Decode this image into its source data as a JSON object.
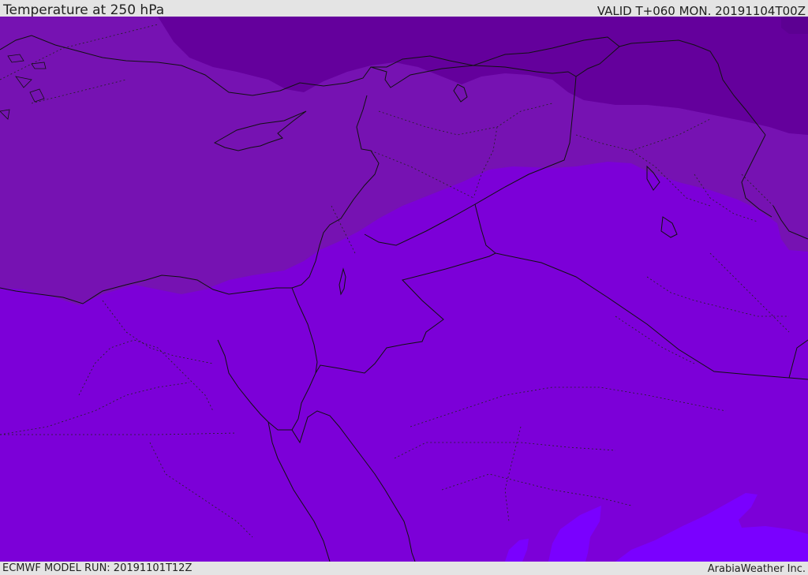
{
  "header": {
    "title": "Temperature at 250 hPa",
    "valid_time": "VALID T+060 MON. 20191104T00Z"
  },
  "footer": {
    "model_run": "ECMWF MODEL RUN: 20191101T12Z",
    "credit": "ArabiaWeather Inc."
  },
  "map": {
    "field": "temperature",
    "level": "250 hPa",
    "shading_colors": {
      "coldest": "#64009c",
      "cold": "#7612b2",
      "mid": "#7c00d8",
      "warm": "#7a00ff"
    },
    "boundary_color": "#111111"
  }
}
